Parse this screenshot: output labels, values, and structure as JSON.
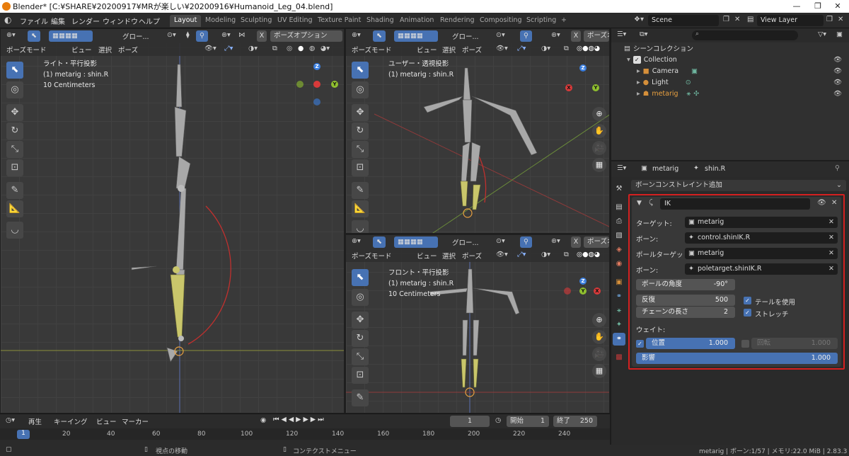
{
  "window": {
    "title": "Blender* [C:¥SHARE¥20200917¥MRが楽しい¥20200916¥Humanoid_Leg_04.blend]",
    "minimize": "—",
    "maximize": "❐",
    "close": "✕"
  },
  "menu": [
    "ファイル",
    "編集",
    "レンダー",
    "ウィンドウ",
    "ヘルプ"
  ],
  "workspaces": [
    "Layout",
    "Modeling",
    "Sculpting",
    "UV Editing",
    "Texture Paint",
    "Shading",
    "Animation",
    "Rendering",
    "Compositing",
    "Scripting"
  ],
  "add_workspace": "+",
  "scene": {
    "label": "Scene",
    "view_layer": "View Layer"
  },
  "viewport_header": {
    "global": "グロー...",
    "global2": "グロー...",
    "global3": "グロー...",
    "pose_options": "ポーズオプション",
    "pose_options_short": "ポーズオ",
    "mode": "ポーズモード",
    "view": "ビュー",
    "select": "選択",
    "pose": "ポーズ",
    "x_label": "X"
  },
  "viewports": [
    {
      "name": "left",
      "title": "ライト・平行投影",
      "object": "(1) metarig : shin.R",
      "scale": "10 Centimeters"
    },
    {
      "name": "top-right",
      "title": "ユーザー・透視投影",
      "object": "(1) metarig : shin.R",
      "scale": ""
    },
    {
      "name": "bottom-right",
      "title": "フロント・平行投影",
      "object": "(1) metarig : shin.R",
      "scale": "10 Centimeters"
    }
  ],
  "axes": {
    "x": "X",
    "y": "Y",
    "z": "Z"
  },
  "outliner": {
    "root": "シーンコレクション",
    "items": [
      {
        "label": "Collection"
      },
      {
        "label": "Camera"
      },
      {
        "label": "Light"
      },
      {
        "label": "metarig"
      }
    ]
  },
  "properties": {
    "breadcrumb_object": "metarig",
    "breadcrumb_bone": "shin.R",
    "add_constraint": "ボーンコンストレイント追加",
    "constraint_name": "IK",
    "target_label": "ターゲット:",
    "target_value": "metarig",
    "bone_label": "ボーン:",
    "bone_value": "control.shinIK.R",
    "pole_target_label": "ポールターゲット:",
    "pole_target_value": "metarig",
    "pole_bone_label": "ボーン:",
    "pole_bone_value": "poletarget.shinIK.R",
    "pole_angle_label": "ポールの角度",
    "pole_angle_value": "-90°",
    "iterations_label": "反復",
    "iterations_value": "500",
    "chain_length_label": "チェーンの長さ",
    "chain_length_value": "2",
    "use_tail_label": "テールを使用",
    "stretch_label": "ストレッチ",
    "weight_label": "ウェイト:",
    "position_label": "位置",
    "position_value": "1.000",
    "rotation_label": "回転",
    "rotation_value": "1.000",
    "influence_label": "影響",
    "influence_value": "1.000"
  },
  "timeline": {
    "playback": "再生",
    "keying": "キーイング",
    "view": "ビュー",
    "marker": "マーカー",
    "current_frame": "1",
    "start_label": "開始",
    "start_value": "1",
    "end_label": "終了",
    "end_value": "250",
    "ruler": [
      "1",
      "20",
      "40",
      "60",
      "80",
      "100",
      "120",
      "140",
      "160",
      "180",
      "200",
      "220",
      "240"
    ]
  },
  "status": {
    "hint1": "視点の移動",
    "hint2": "コンテクストメニュー",
    "info": "metarig | ボーン:1/57 | メモリ:22.0 MiB | 2.83.3"
  },
  "colors": {
    "accent": "#4772b3",
    "highlight_box": "#d42020",
    "ik_arc": "#c0302e",
    "selected_bone": "#c9c66b"
  }
}
